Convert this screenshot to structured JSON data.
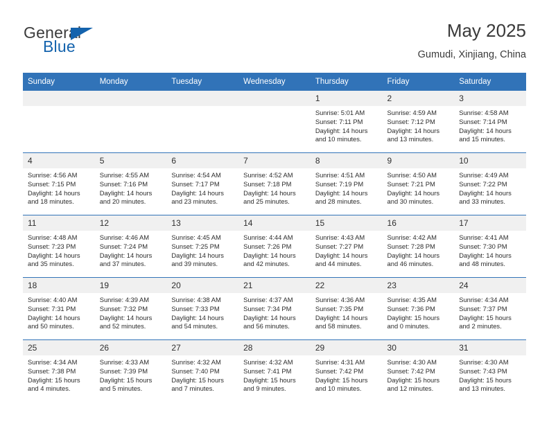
{
  "brand": {
    "name_part1": "General",
    "name_part2": "Blue",
    "logo_icon": "blue-triangle-icon",
    "accent_color": "#1463ad"
  },
  "header": {
    "title": "May 2025",
    "subtitle": "Gumudi, Xinjiang, China"
  },
  "theme": {
    "header_row_color": "#3173b8",
    "daynum_band_color": "#f0f0f0",
    "text_color": "#2b2b2b"
  },
  "calendar": {
    "weekday_headers": [
      "Sunday",
      "Monday",
      "Tuesday",
      "Wednesday",
      "Thursday",
      "Friday",
      "Saturday"
    ],
    "labels": {
      "sunrise": "Sunrise:",
      "sunset": "Sunset:",
      "daylight": "Daylight:"
    },
    "weeks": [
      [
        {
          "day": "",
          "lines": []
        },
        {
          "day": "",
          "lines": []
        },
        {
          "day": "",
          "lines": []
        },
        {
          "day": "",
          "lines": []
        },
        {
          "day": "1",
          "lines": [
            "Sunrise: 5:01 AM",
            "Sunset: 7:11 PM",
            "Daylight: 14 hours",
            "and 10 minutes."
          ]
        },
        {
          "day": "2",
          "lines": [
            "Sunrise: 4:59 AM",
            "Sunset: 7:12 PM",
            "Daylight: 14 hours",
            "and 13 minutes."
          ]
        },
        {
          "day": "3",
          "lines": [
            "Sunrise: 4:58 AM",
            "Sunset: 7:14 PM",
            "Daylight: 14 hours",
            "and 15 minutes."
          ]
        }
      ],
      [
        {
          "day": "4",
          "lines": [
            "Sunrise: 4:56 AM",
            "Sunset: 7:15 PM",
            "Daylight: 14 hours",
            "and 18 minutes."
          ]
        },
        {
          "day": "5",
          "lines": [
            "Sunrise: 4:55 AM",
            "Sunset: 7:16 PM",
            "Daylight: 14 hours",
            "and 20 minutes."
          ]
        },
        {
          "day": "6",
          "lines": [
            "Sunrise: 4:54 AM",
            "Sunset: 7:17 PM",
            "Daylight: 14 hours",
            "and 23 minutes."
          ]
        },
        {
          "day": "7",
          "lines": [
            "Sunrise: 4:52 AM",
            "Sunset: 7:18 PM",
            "Daylight: 14 hours",
            "and 25 minutes."
          ]
        },
        {
          "day": "8",
          "lines": [
            "Sunrise: 4:51 AM",
            "Sunset: 7:19 PM",
            "Daylight: 14 hours",
            "and 28 minutes."
          ]
        },
        {
          "day": "9",
          "lines": [
            "Sunrise: 4:50 AM",
            "Sunset: 7:21 PM",
            "Daylight: 14 hours",
            "and 30 minutes."
          ]
        },
        {
          "day": "10",
          "lines": [
            "Sunrise: 4:49 AM",
            "Sunset: 7:22 PM",
            "Daylight: 14 hours",
            "and 33 minutes."
          ]
        }
      ],
      [
        {
          "day": "11",
          "lines": [
            "Sunrise: 4:48 AM",
            "Sunset: 7:23 PM",
            "Daylight: 14 hours",
            "and 35 minutes."
          ]
        },
        {
          "day": "12",
          "lines": [
            "Sunrise: 4:46 AM",
            "Sunset: 7:24 PM",
            "Daylight: 14 hours",
            "and 37 minutes."
          ]
        },
        {
          "day": "13",
          "lines": [
            "Sunrise: 4:45 AM",
            "Sunset: 7:25 PM",
            "Daylight: 14 hours",
            "and 39 minutes."
          ]
        },
        {
          "day": "14",
          "lines": [
            "Sunrise: 4:44 AM",
            "Sunset: 7:26 PM",
            "Daylight: 14 hours",
            "and 42 minutes."
          ]
        },
        {
          "day": "15",
          "lines": [
            "Sunrise: 4:43 AM",
            "Sunset: 7:27 PM",
            "Daylight: 14 hours",
            "and 44 minutes."
          ]
        },
        {
          "day": "16",
          "lines": [
            "Sunrise: 4:42 AM",
            "Sunset: 7:28 PM",
            "Daylight: 14 hours",
            "and 46 minutes."
          ]
        },
        {
          "day": "17",
          "lines": [
            "Sunrise: 4:41 AM",
            "Sunset: 7:30 PM",
            "Daylight: 14 hours",
            "and 48 minutes."
          ]
        }
      ],
      [
        {
          "day": "18",
          "lines": [
            "Sunrise: 4:40 AM",
            "Sunset: 7:31 PM",
            "Daylight: 14 hours",
            "and 50 minutes."
          ]
        },
        {
          "day": "19",
          "lines": [
            "Sunrise: 4:39 AM",
            "Sunset: 7:32 PM",
            "Daylight: 14 hours",
            "and 52 minutes."
          ]
        },
        {
          "day": "20",
          "lines": [
            "Sunrise: 4:38 AM",
            "Sunset: 7:33 PM",
            "Daylight: 14 hours",
            "and 54 minutes."
          ]
        },
        {
          "day": "21",
          "lines": [
            "Sunrise: 4:37 AM",
            "Sunset: 7:34 PM",
            "Daylight: 14 hours",
            "and 56 minutes."
          ]
        },
        {
          "day": "22",
          "lines": [
            "Sunrise: 4:36 AM",
            "Sunset: 7:35 PM",
            "Daylight: 14 hours",
            "and 58 minutes."
          ]
        },
        {
          "day": "23",
          "lines": [
            "Sunrise: 4:35 AM",
            "Sunset: 7:36 PM",
            "Daylight: 15 hours",
            "and 0 minutes."
          ]
        },
        {
          "day": "24",
          "lines": [
            "Sunrise: 4:34 AM",
            "Sunset: 7:37 PM",
            "Daylight: 15 hours",
            "and 2 minutes."
          ]
        }
      ],
      [
        {
          "day": "25",
          "lines": [
            "Sunrise: 4:34 AM",
            "Sunset: 7:38 PM",
            "Daylight: 15 hours",
            "and 4 minutes."
          ]
        },
        {
          "day": "26",
          "lines": [
            "Sunrise: 4:33 AM",
            "Sunset: 7:39 PM",
            "Daylight: 15 hours",
            "and 5 minutes."
          ]
        },
        {
          "day": "27",
          "lines": [
            "Sunrise: 4:32 AM",
            "Sunset: 7:40 PM",
            "Daylight: 15 hours",
            "and 7 minutes."
          ]
        },
        {
          "day": "28",
          "lines": [
            "Sunrise: 4:32 AM",
            "Sunset: 7:41 PM",
            "Daylight: 15 hours",
            "and 9 minutes."
          ]
        },
        {
          "day": "29",
          "lines": [
            "Sunrise: 4:31 AM",
            "Sunset: 7:42 PM",
            "Daylight: 15 hours",
            "and 10 minutes."
          ]
        },
        {
          "day": "30",
          "lines": [
            "Sunrise: 4:30 AM",
            "Sunset: 7:42 PM",
            "Daylight: 15 hours",
            "and 12 minutes."
          ]
        },
        {
          "day": "31",
          "lines": [
            "Sunrise: 4:30 AM",
            "Sunset: 7:43 PM",
            "Daylight: 15 hours",
            "and 13 minutes."
          ]
        }
      ]
    ]
  }
}
